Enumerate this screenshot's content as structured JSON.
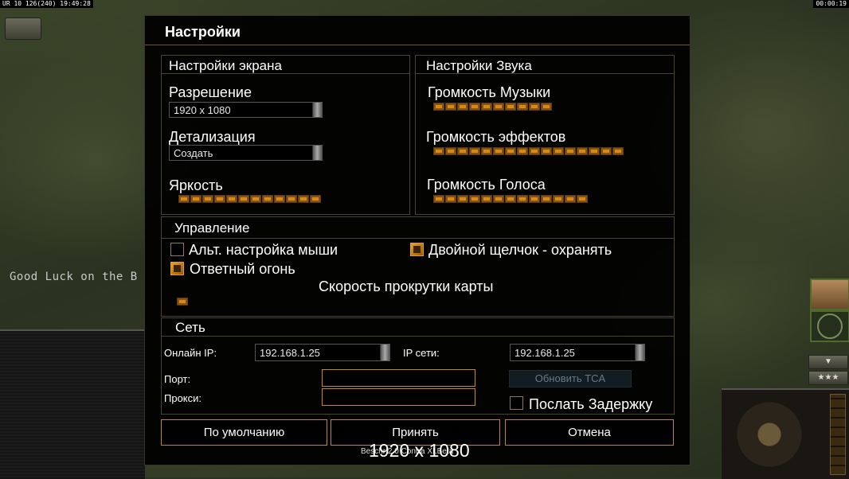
{
  "hud": {
    "top_left_status": "UR 10 126(240) 19:49:28",
    "top_right_clock": "00:00:19",
    "chat_message": "Good Luck on the B",
    "stars": "★★★"
  },
  "dialog": {
    "title": "Настройки",
    "screen": {
      "title": "Настройки экрана",
      "resolution_label": "Разрешение",
      "resolution_value": "1920 x 1080",
      "detail_label": "Детализация",
      "detail_value": "Создать",
      "brightness_label": "Яркость",
      "brightness_level": 12
    },
    "sound": {
      "title": "Настройки Звука",
      "music_label": "Громкость Музыки",
      "music_level": 10,
      "effects_label": "Громкость эффектов",
      "effects_level": 16,
      "voice_label": "Громкость Голоса",
      "voice_level": 13
    },
    "controls": {
      "title": "Управление",
      "alt_mouse_label": "Альт. настройка мыши",
      "alt_mouse_checked": false,
      "double_click_label": "Двойной щелчок - охранять",
      "double_click_checked": true,
      "retaliation_label": "Ответный огонь",
      "retaliation_checked": true,
      "scroll_speed_label": "Скорость прокрутки карты"
    },
    "network": {
      "title": "Сеть",
      "online_ip_label": "Онлайн IP:",
      "online_ip_value": "192.168.1.25",
      "lan_ip_label": "IP сети:",
      "lan_ip_value": "192.168.1.25",
      "port_label": "Порт:",
      "proxy_label": "Прокси:",
      "update_tca_label": "Обновить TCA",
      "send_delay_label": "Послать Задержку",
      "send_delay_checked": false
    },
    "buttons": {
      "defaults": "По умолчанию",
      "accept": "Принять",
      "cancel": "Отмена"
    },
    "version_text": "Beschr 2.0 Contra XI.Beta",
    "resolution_overlay": "1920 x 1080"
  }
}
